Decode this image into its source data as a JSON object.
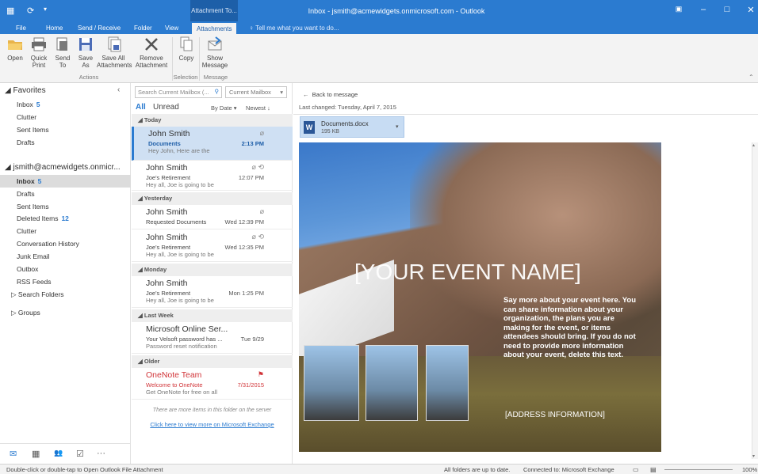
{
  "titlebar": {
    "context_tab": "Attachment To...",
    "window_title": "Inbox - jsmith@acmewidgets.onmicrosoft.com - Outlook"
  },
  "tabs": [
    "File",
    "Home",
    "Send / Receive",
    "Folder",
    "View",
    "Attachments"
  ],
  "tell_me": "Tell me what you want to do...",
  "ribbon": {
    "open": "Open",
    "quick_print": "Quick Print",
    "send_to": "Send To",
    "save_as": "Save As",
    "save_all": "Save All Attachments",
    "remove": "Remove Attachment",
    "copy": "Copy",
    "show_message": "Show Message",
    "group_actions": "Actions",
    "group_selection": "Selection",
    "group_message": "Message"
  },
  "favorites": {
    "header": "Favorites",
    "items": [
      {
        "label": "Inbox",
        "count": "5"
      },
      {
        "label": "Clutter",
        "count": ""
      },
      {
        "label": "Sent Items",
        "count": ""
      },
      {
        "label": "Drafts",
        "count": ""
      }
    ]
  },
  "account": {
    "header": "jsmith@acmewidgets.onmicr...",
    "items": [
      {
        "label": "Inbox",
        "count": "5"
      },
      {
        "label": "Drafts",
        "count": ""
      },
      {
        "label": "Sent Items",
        "count": ""
      },
      {
        "label": "Deleted Items",
        "count": "12"
      },
      {
        "label": "Clutter",
        "count": ""
      },
      {
        "label": "Conversation History",
        "count": ""
      },
      {
        "label": "Junk Email",
        "count": ""
      },
      {
        "label": "Outbox",
        "count": ""
      },
      {
        "label": "RSS Feeds",
        "count": ""
      },
      {
        "label": "Search Folders",
        "count": ""
      }
    ],
    "groups": "Groups"
  },
  "list": {
    "search_placeholder": "Search Current Mailbox (...",
    "scope": "Current Mailbox",
    "all": "All",
    "unread": "Unread",
    "sort": "By Date",
    "order": "Newest",
    "groups": {
      "today": "Today",
      "yesterday": "Yesterday",
      "monday": "Monday",
      "last_week": "Last Week",
      "older": "Older"
    },
    "messages": [
      {
        "from": "John Smith",
        "subject": "Documents",
        "preview": "Hey John,  Here are the",
        "time": "2:13 PM"
      },
      {
        "from": "John Smith",
        "subject": "Joe's Retirement",
        "preview": "Hey all,  Joe is going to be",
        "time": "12:07 PM"
      },
      {
        "from": "John Smith",
        "subject": "Requested Documents",
        "preview": "",
        "time": "Wed 12:39 PM"
      },
      {
        "from": "John Smith",
        "subject": "Joe's Retirement",
        "preview": "Hey all,  Joe is going to be",
        "time": "Wed 12:35 PM"
      },
      {
        "from": "John Smith",
        "subject": "Joe's Retirement",
        "preview": "Hey all,  Joe is going to be",
        "time": "Mon 1:25 PM"
      },
      {
        "from": "Microsoft Online Ser...",
        "subject": "Your Velsoft password has ...",
        "preview": "Password reset notification",
        "time": "Tue 9/29"
      },
      {
        "from": "OneNote Team",
        "subject": "Welcome to OneNote",
        "preview": "Get OneNote for free on all",
        "time": "7/31/2015"
      }
    ],
    "more_note": "There are more items in this folder on the server",
    "more_link": "Click here to view more on Microsoft Exchange"
  },
  "reading": {
    "back": "Back to message",
    "last_changed": "Last changed:  Tuesday, April 7, 2015",
    "attachment_name": "Documents.docx",
    "attachment_size": "195 KB",
    "event_name": "[YOUR EVENT NAME]",
    "event_text": "Say more about your event here. You can share information about your organization, the plans you are making for the event, or items attendees should bring. If you do not need to provide  more information about your event, delete this text.",
    "address": "[ADDRESS INFORMATION]"
  },
  "status": {
    "left": "Double-click or double-tap to Open Outlook File Attachment",
    "sync": "All folders are up to date.",
    "connected": "Connected to: Microsoft Exchange",
    "zoom": "100%"
  },
  "colors": {
    "accent": "#2b7bd0",
    "selected": "#cfe0f3",
    "flag": "#d13438"
  }
}
